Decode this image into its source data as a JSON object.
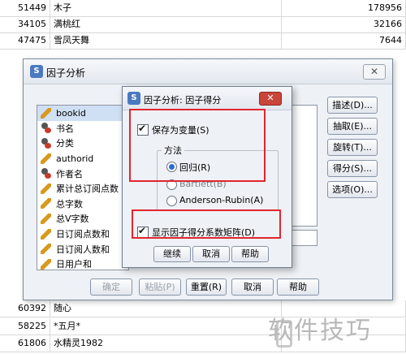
{
  "spreadsheet": {
    "top_rows": [
      {
        "id": "51449",
        "name": "木子",
        "value": "178956"
      },
      {
        "id": "34105",
        "name": "满桃红",
        "value": "32166"
      },
      {
        "id": "47475",
        "name": "雪凤天舞",
        "value": "7644"
      }
    ],
    "bottom_rows": [
      {
        "id": "60392",
        "name": "随心",
        "value": ""
      },
      {
        "id": "58225",
        "name": "*五月*",
        "value": ""
      },
      {
        "id": "61806",
        "name": "水精灵1982",
        "value": ""
      }
    ]
  },
  "factor_dialog": {
    "title": "因子分析",
    "close_label": "✕",
    "variables": [
      {
        "label": "bookid",
        "icon": "ruler-icon"
      },
      {
        "label": "书名",
        "icon": "person-icon"
      },
      {
        "label": "分类",
        "icon": "person-icon"
      },
      {
        "label": "authorid",
        "icon": "ruler-icon"
      },
      {
        "label": "作者名",
        "icon": "person-icon"
      },
      {
        "label": "累计总订阅点数",
        "icon": "ruler-icon"
      },
      {
        "label": "总字数",
        "icon": "ruler-icon"
      },
      {
        "label": "总V字数",
        "icon": "ruler-icon"
      },
      {
        "label": "日订阅点数和",
        "icon": "ruler-icon"
      },
      {
        "label": "日订阅人数和",
        "icon": "ruler-icon"
      },
      {
        "label": "日用户和",
        "icon": "ruler-icon"
      }
    ],
    "right_buttons": [
      "描述(D)...",
      "抽取(E)...",
      "旋转(T)...",
      "得分(S)...",
      "选项(O)..."
    ],
    "bottom_buttons": {
      "ok": "确定",
      "paste": "粘贴(P)",
      "reset": "重置(R)",
      "cancel": "取消",
      "help": "帮助"
    }
  },
  "score_dialog": {
    "title": "因子分析: 因子得分",
    "close_label": "✕",
    "save_as_variables": {
      "label": "保存为变量(S)",
      "checked": true
    },
    "method_group_title": "方法",
    "methods": [
      {
        "label": "回归(R)",
        "selected": true
      },
      {
        "label": "Bartlett(B)",
        "selected": false
      },
      {
        "label": "Anderson-Rubin(A)",
        "selected": false
      }
    ],
    "show_matrix": {
      "label": "显示因子得分系数矩阵(D)",
      "checked": true
    },
    "buttons": {
      "continue": "继续",
      "cancel": "取消",
      "help": "帮助"
    }
  },
  "watermark": "软件技巧",
  "colors": {
    "highlight": "#e2252f",
    "accent": "#2e6bd1"
  }
}
